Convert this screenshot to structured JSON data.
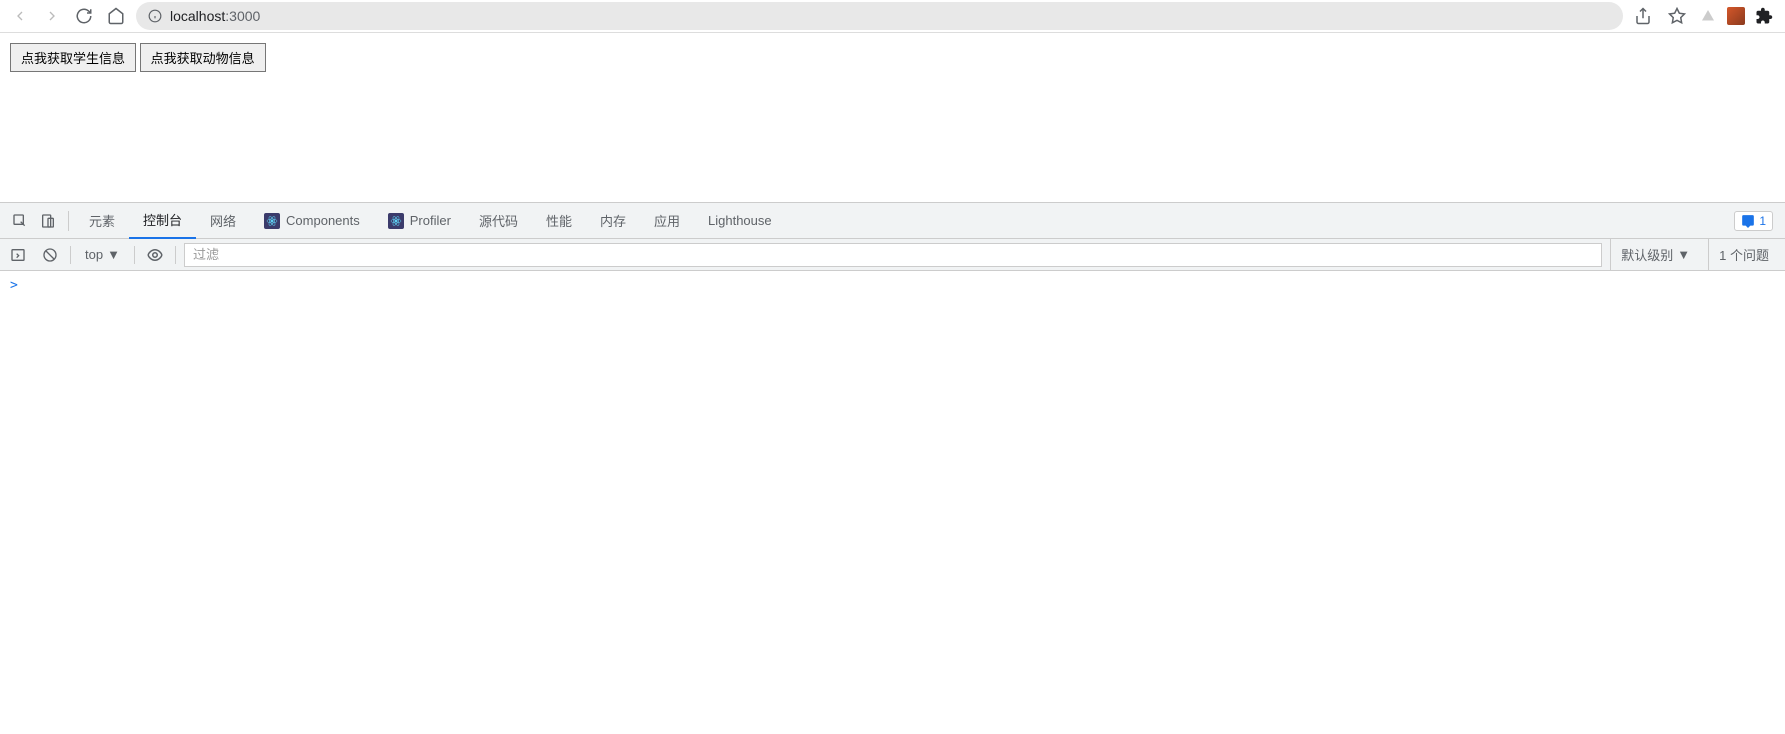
{
  "browser": {
    "url_host": "localhost",
    "url_port": ":3000"
  },
  "page": {
    "button_students": "点我获取学生信息",
    "button_animals": "点我获取动物信息"
  },
  "devtools": {
    "tabs": {
      "elements": "元素",
      "console": "控制台",
      "network": "网络",
      "components": "Components",
      "profiler": "Profiler",
      "sources": "源代码",
      "performance": "性能",
      "memory": "内存",
      "application": "应用",
      "lighthouse": "Lighthouse"
    },
    "issues_badge": "1",
    "console": {
      "context": "top",
      "filter_placeholder": "过滤",
      "level": "默认级别",
      "issues_text": "1 个问题",
      "prompt": ">"
    }
  }
}
